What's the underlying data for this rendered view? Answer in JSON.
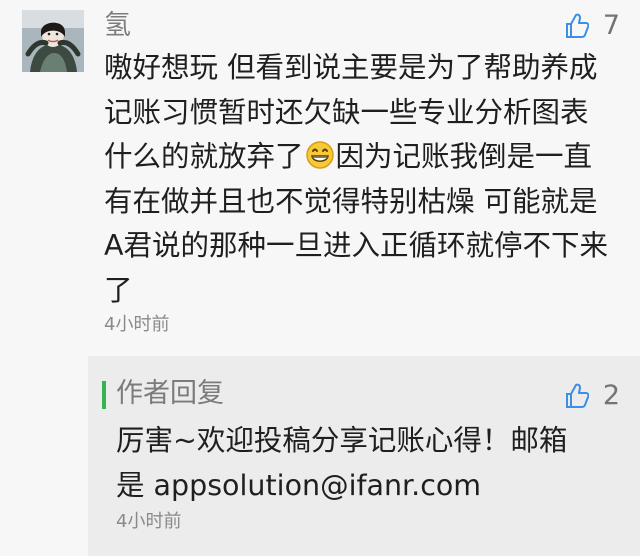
{
  "comment": {
    "username": "氢",
    "likes": "7",
    "lines": [
      "嗷好想玩 但看到说主要是为了帮助养成",
      "记账习惯暂时还欠缺一些专业分析图表",
      "什么的就放弃了",
      "因为记账我倒是一直",
      "有在做并且也不觉得特别枯燥 可能就是",
      "A君说的那种一旦进入正循环就停不下来",
      "了"
    ],
    "time": "4小时前",
    "emoji": "grinning-face-icon"
  },
  "reply": {
    "author_label": "作者回复",
    "likes": "2",
    "lines": [
      "厉害~欢迎投稿分享记账心得！邮箱",
      "是 appsolution@ifanr.com"
    ],
    "time": "4小时前"
  },
  "colors": {
    "accent_green": "#35b44f",
    "like_blue": "#3d8fe6",
    "reply_bg": "#ececec",
    "page_bg": "#f7f7f7"
  }
}
